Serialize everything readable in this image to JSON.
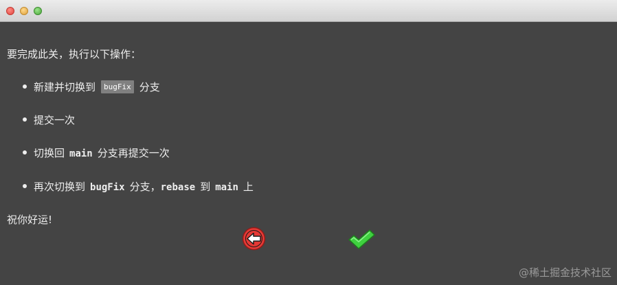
{
  "intro": "要完成此关，执行以下操作：",
  "tasks": {
    "t1": {
      "pre": "新建并切换到",
      "code": "bugFix",
      "post": "分支"
    },
    "t2": {
      "text": "提交一次"
    },
    "t3": {
      "pre": "切换回",
      "code": "main",
      "post": "分支再提交一次"
    },
    "t4": {
      "pre": "再次切换到",
      "code1": "bugFix",
      "mid1": "分支，",
      "code2": "rebase",
      "mid2": "到",
      "code3": "main",
      "post": "上"
    }
  },
  "outro": "祝你好运!",
  "buttons": {
    "back_icon": "back-arrow-icon",
    "confirm_icon": "checkmark-icon"
  },
  "colors": {
    "background": "#444444",
    "back_red": "#e53935",
    "confirm_green": "#3fd13f"
  },
  "watermark": "@稀土掘金技术社区"
}
